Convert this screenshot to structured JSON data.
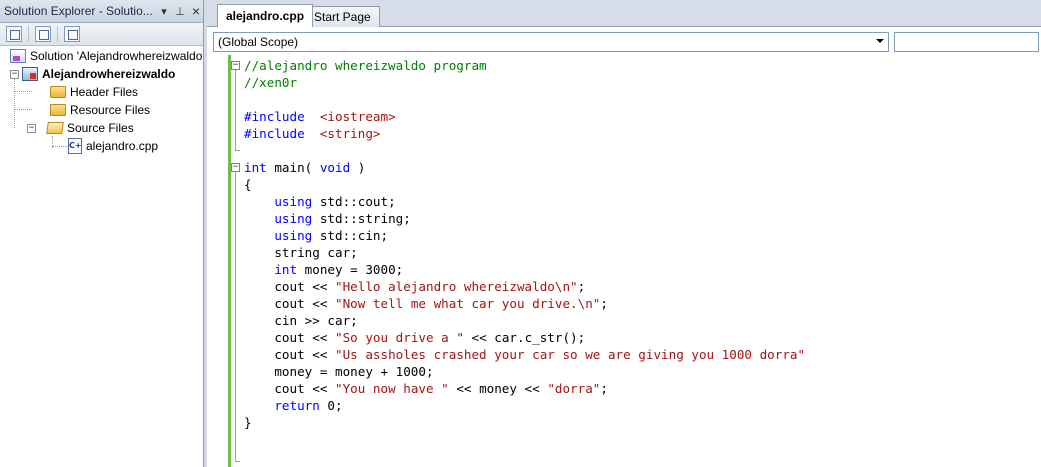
{
  "solution_explorer": {
    "title": "Solution Explorer - Solutio...",
    "pin": "⊥",
    "close": "×",
    "dropdown": "▾",
    "tree": {
      "solution": "Solution 'Alejandrowhereizwaldo",
      "project": "Alejandrowhereizwaldo",
      "header_files": "Header Files",
      "resource_files": "Resource Files",
      "source_files": "Source Files",
      "file": "alejandro.cpp"
    }
  },
  "editor": {
    "tabs": [
      "alejandro.cpp",
      "Start Page"
    ],
    "scope": "(Global Scope)",
    "code": [
      [
        [
          "cm",
          "//alejandro whereizwaldo program"
        ]
      ],
      [
        [
          "cm",
          "//xen0r"
        ]
      ],
      [],
      [
        [
          "kw",
          "#include"
        ],
        [
          "",
          "  "
        ],
        [
          "st",
          "<iostream>"
        ]
      ],
      [
        [
          "kw",
          "#include"
        ],
        [
          "",
          "  "
        ],
        [
          "st",
          "<string>"
        ]
      ],
      [],
      [
        [
          "kw",
          "int"
        ],
        [
          "",
          " main( "
        ],
        [
          "kw",
          "void"
        ],
        [
          "",
          " )"
        ]
      ],
      [
        [
          "",
          "{"
        ]
      ],
      [
        [
          "",
          "    "
        ],
        [
          "kw",
          "using"
        ],
        [
          "",
          " std::cout;"
        ]
      ],
      [
        [
          "",
          "    "
        ],
        [
          "kw",
          "using"
        ],
        [
          "",
          " std::string;"
        ]
      ],
      [
        [
          "",
          "    "
        ],
        [
          "kw",
          "using"
        ],
        [
          "",
          " std::cin;"
        ]
      ],
      [
        [
          "",
          "    string car;"
        ]
      ],
      [
        [
          "",
          "    "
        ],
        [
          "kw",
          "int"
        ],
        [
          "",
          " money = 3000;"
        ]
      ],
      [
        [
          "",
          "    cout << "
        ],
        [
          "st",
          "\"Hello alejandro whereizwaldo\\n\""
        ],
        [
          "",
          ";"
        ]
      ],
      [
        [
          "",
          "    cout << "
        ],
        [
          "st",
          "\"Now tell me what car you drive.\\n\""
        ],
        [
          "",
          ";"
        ]
      ],
      [
        [
          "",
          "    cin >> car;"
        ]
      ],
      [
        [
          "",
          "    cout << "
        ],
        [
          "st",
          "\"So you drive a \""
        ],
        [
          "",
          " << car.c_str();"
        ]
      ],
      [
        [
          "",
          "    cout << "
        ],
        [
          "st",
          "\"Us assholes crashed your car so we are giving you 1000 dorra\""
        ]
      ],
      [
        [
          "",
          "    money = money + 1000;"
        ]
      ],
      [
        [
          "",
          "    cout << "
        ],
        [
          "st",
          "\"You now have \""
        ],
        [
          "",
          " << money << "
        ],
        [
          "st",
          "\"dorra\""
        ],
        [
          "",
          ";"
        ]
      ],
      [
        [
          "",
          "    "
        ],
        [
          "kw",
          "return"
        ],
        [
          "",
          " 0;"
        ]
      ],
      [
        [
          "",
          "}"
        ]
      ]
    ]
  }
}
